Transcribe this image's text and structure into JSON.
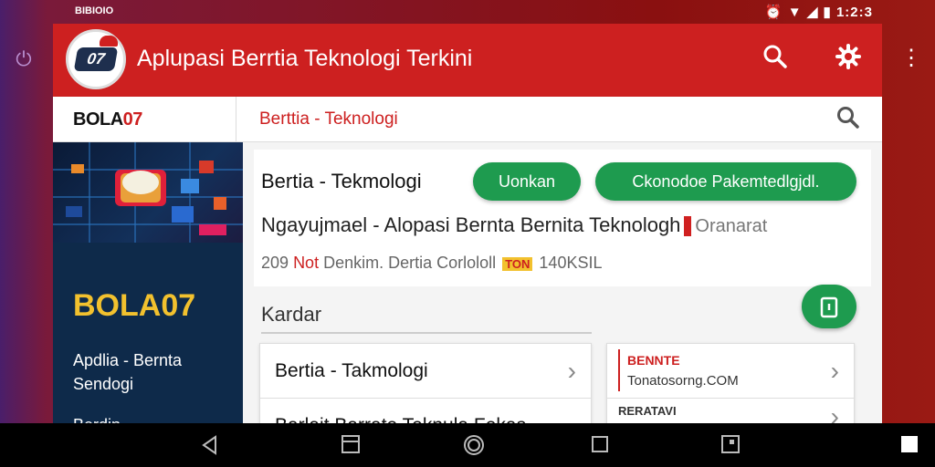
{
  "status": {
    "left_text": "BIBIOIO",
    "right_text": "1:2:3"
  },
  "app": {
    "title": "Aplupasi Berrtia Teknologi Terkini",
    "logo_text": "07"
  },
  "tabbar": {
    "brand_main": "BOLA",
    "brand_highlight": "07",
    "title": "Berttia - Teknologi"
  },
  "sidebar": {
    "brand": "BOLA07",
    "text": "Apdlia - Bernta Sendogi",
    "item_partial": "Berdin"
  },
  "card": {
    "heading": "Bertia - Tekmologi",
    "pill_left": "Uonkan",
    "pill_right": "Ckonodoe Pakemtedlgjdl.",
    "line_main": "Ngayujmael - Alopasi Bernta Bernita Teknologh",
    "line_muted": "Oranarat",
    "meta_num": "209",
    "meta_red": "Not",
    "meta_text": "Denkim. Dertia",
    "meta_text2": "Corlololl",
    "meta_flag": "TON",
    "meta_tail": "140KSIL"
  },
  "section": {
    "label": "Kardar"
  },
  "list": {
    "items": [
      {
        "label": "Bertia - Takmologi"
      },
      {
        "label": "Barlait Barrate Teknula Fekas"
      }
    ]
  },
  "news": {
    "tag": "BENNTE",
    "url": "Tonatosorng.COM",
    "tag2": "RERATAVI"
  },
  "icons": {
    "power": "power-icon",
    "search": "search-icon",
    "settings": "gear-icon",
    "overflow": "more-vert-icon",
    "chevron": "chevron-right-icon",
    "fab": "document-icon",
    "nav_back": "back-triangle-icon",
    "nav_recent": "recent-square-icon",
    "nav_home": "home-circle-icon"
  },
  "colors": {
    "primary": "#cd2020",
    "accent_green": "#1e9b4f",
    "sidebar_bg": "#0e2a4a",
    "brand_yellow": "#f2c12e"
  }
}
